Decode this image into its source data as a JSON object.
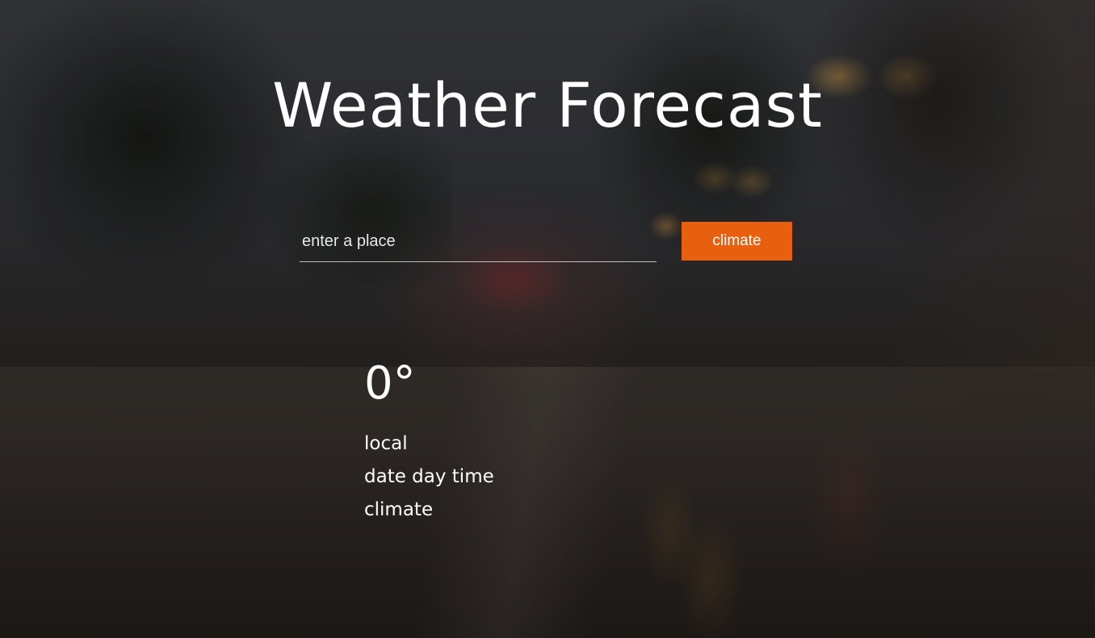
{
  "header": {
    "title": "Weather Forecast"
  },
  "search": {
    "placeholder": "enter a place",
    "value": "",
    "button_label": "climate"
  },
  "weather": {
    "temperature": "0°",
    "location": "local",
    "datetime": "date day time",
    "condition": "climate"
  },
  "colors": {
    "accent": "#e8600f",
    "text": "#ffffff"
  }
}
